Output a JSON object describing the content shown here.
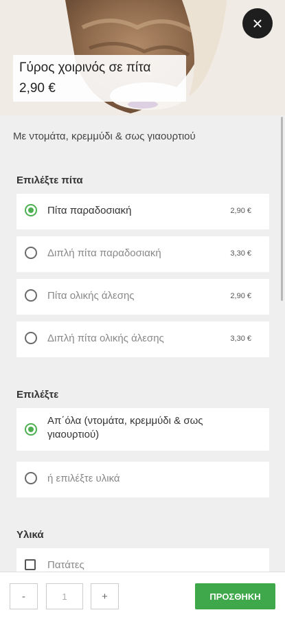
{
  "product": {
    "title": "Γύρος χοιρινός σε πίτα",
    "price": "2,90 €",
    "description": "Με ντομάτα, κρεμμύδι & σως γιαουρτιού"
  },
  "sections": [
    {
      "title": "Επιλέξτε πίτα",
      "options": [
        {
          "label": "Πίτα παραδοσιακή",
          "price": "2,90 €",
          "selected": true
        },
        {
          "label": "Διπλή πίτα παραδοσιακή",
          "price": "3,30 €",
          "selected": false
        },
        {
          "label": "Πίτα ολικής άλεσης",
          "price": "2,90 €",
          "selected": false
        },
        {
          "label": "Διπλή πίτα ολικής άλεσης",
          "price": "3,30 €",
          "selected": false
        }
      ]
    },
    {
      "title": "Επιλέξτε",
      "options": [
        {
          "label": "Απ΄όλα (ντομάτα, κρεμμύδι & σως γιαουρτιού)",
          "selected": true
        },
        {
          "label": "ή επιλέξτε υλικά",
          "selected": false
        }
      ]
    },
    {
      "title": "Υλικά",
      "options": [
        {
          "label": "Πατάτες",
          "checked": false
        }
      ]
    }
  ],
  "footer": {
    "minus_label": "-",
    "quantity": "1",
    "plus_label": "+",
    "add_label": "ΠΡΟΣΘΗΚΗ"
  },
  "colors": {
    "accent": "#3ea84a",
    "close_button": "#1e1e1e"
  },
  "icons": {
    "close": "close-icon"
  }
}
